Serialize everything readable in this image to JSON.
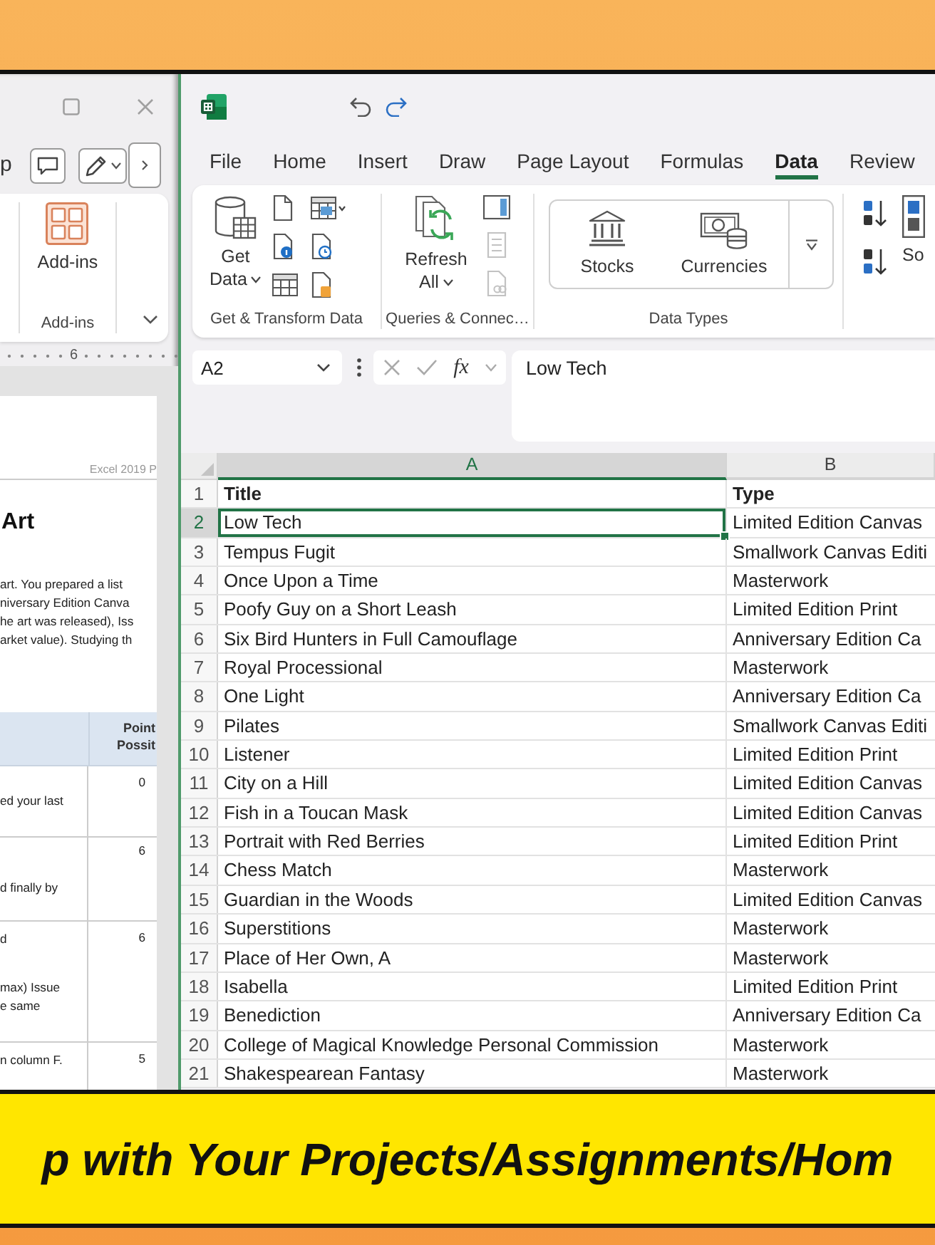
{
  "word_window": {
    "toolbar": {
      "label": "p"
    },
    "ribbon": {
      "button": "Add-ins",
      "group_label": "Add-ins"
    },
    "ruler": {
      "label": "6"
    },
    "document": {
      "header_note": "Excel 2019 P",
      "heading": "Art",
      "paragraph_lines": [
        "art. You prepared a list",
        "niversary Edition Canva",
        "he art was released), Iss",
        "arket value). Studying th"
      ],
      "table": {
        "header_lines": [
          "Point",
          "Possit"
        ],
        "rows": [
          {
            "text_lines": [
              "ed your last"
            ],
            "points": "0"
          },
          {
            "text_lines": [
              "d finally by"
            ],
            "points": "6"
          },
          {
            "text_lines": [
              "d",
              "max) Issue",
              "e same"
            ],
            "points": "6"
          },
          {
            "text_lines": [
              "n column F."
            ],
            "points": "5"
          }
        ]
      }
    }
  },
  "excel_window": {
    "tabs": [
      {
        "label": "File",
        "selected": false
      },
      {
        "label": "Home",
        "selected": false
      },
      {
        "label": "Insert",
        "selected": false
      },
      {
        "label": "Draw",
        "selected": false
      },
      {
        "label": "Page Layout",
        "selected": false
      },
      {
        "label": "Formulas",
        "selected": false
      },
      {
        "label": "Data",
        "selected": true
      },
      {
        "label": "Review",
        "selected": false
      }
    ],
    "ribbon_groups": [
      {
        "kind": "get-transform",
        "label": "Get & Transform Data",
        "button_lines": [
          "Get",
          "Data"
        ]
      },
      {
        "kind": "queries",
        "label": "Queries & Connec…",
        "button_lines": [
          "Refresh",
          "All"
        ],
        "tools": [
          {
            "disabled": false
          },
          {
            "disabled": true
          },
          {
            "disabled": true
          }
        ]
      },
      {
        "kind": "data-types",
        "label": "Data Types",
        "items": [
          "Stocks",
          "Currencies"
        ]
      },
      {
        "kind": "sort",
        "button": "So"
      }
    ],
    "formula_bar": {
      "name_box": "A2",
      "function_label": "fx",
      "value": "Low Tech"
    },
    "grid": {
      "columns": [
        {
          "label": "A",
          "selected": true
        },
        {
          "label": "B",
          "selected": false
        }
      ],
      "rows": [
        {
          "number": "1",
          "bold": true,
          "selected": false,
          "cells": [
            "Title",
            "Type"
          ]
        },
        {
          "number": "2",
          "bold": false,
          "selected": true,
          "cells": [
            "Low Tech",
            "Limited Edition Canvas"
          ]
        },
        {
          "number": "3",
          "bold": false,
          "selected": false,
          "cells": [
            "Tempus Fugit",
            "Smallwork Canvas Editi"
          ]
        },
        {
          "number": "4",
          "bold": false,
          "selected": false,
          "cells": [
            "Once Upon a Time",
            "Masterwork"
          ]
        },
        {
          "number": "5",
          "bold": false,
          "selected": false,
          "cells": [
            "Poofy Guy on a Short Leash",
            "Limited Edition Print"
          ]
        },
        {
          "number": "6",
          "bold": false,
          "selected": false,
          "cells": [
            "Six Bird Hunters in Full Camouflage",
            "Anniversary Edition Ca"
          ]
        },
        {
          "number": "7",
          "bold": false,
          "selected": false,
          "cells": [
            "Royal Processional",
            "Masterwork"
          ]
        },
        {
          "number": "8",
          "bold": false,
          "selected": false,
          "cells": [
            "One Light",
            "Anniversary Edition Ca"
          ]
        },
        {
          "number": "9",
          "bold": false,
          "selected": false,
          "cells": [
            "Pilates",
            "Smallwork Canvas Editi"
          ]
        },
        {
          "number": "10",
          "bold": false,
          "selected": false,
          "cells": [
            "Listener",
            "Limited Edition Print"
          ]
        },
        {
          "number": "11",
          "bold": false,
          "selected": false,
          "cells": [
            "City on a Hill",
            "Limited Edition Canvas"
          ]
        },
        {
          "number": "12",
          "bold": false,
          "selected": false,
          "cells": [
            "Fish in a Toucan Mask",
            "Limited Edition Canvas"
          ]
        },
        {
          "number": "13",
          "bold": false,
          "selected": false,
          "cells": [
            "Portrait with Red Berries",
            "Limited Edition Print"
          ]
        },
        {
          "number": "14",
          "bold": false,
          "selected": false,
          "cells": [
            "Chess Match",
            "Masterwork"
          ]
        },
        {
          "number": "15",
          "bold": false,
          "selected": false,
          "cells": [
            "Guardian in the Woods",
            "Limited Edition Canvas"
          ]
        },
        {
          "number": "16",
          "bold": false,
          "selected": false,
          "cells": [
            "Superstitions",
            "Masterwork"
          ]
        },
        {
          "number": "17",
          "bold": false,
          "selected": false,
          "cells": [
            "Place of Her Own, A",
            "Masterwork"
          ]
        },
        {
          "number": "18",
          "bold": false,
          "selected": false,
          "cells": [
            "Isabella",
            "Limited Edition Print"
          ]
        },
        {
          "number": "19",
          "bold": false,
          "selected": false,
          "cells": [
            "Benediction",
            "Anniversary Edition Ca"
          ]
        },
        {
          "number": "20",
          "bold": false,
          "selected": false,
          "cells": [
            "College of Magical Knowledge Personal Commission",
            "Masterwork"
          ]
        },
        {
          "number": "21",
          "bold": false,
          "selected": false,
          "cells": [
            "Shakespearean Fantasy",
            "Masterwork"
          ]
        }
      ]
    }
  },
  "banner": {
    "text": "p with Your Projects/Assignments/Hom"
  }
}
